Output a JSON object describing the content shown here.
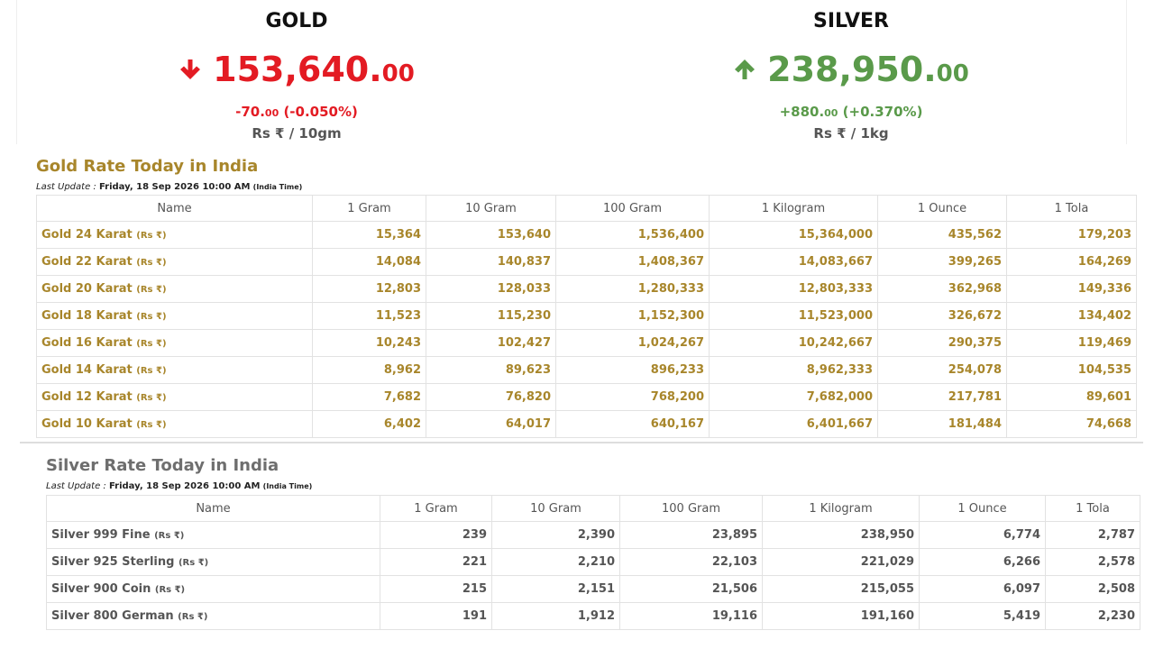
{
  "gold_ticker": {
    "title": "GOLD",
    "price_main": "153,640.",
    "price_decimal": "00",
    "change_amount": "-70.",
    "change_decimal": "00",
    "change_percent": " (-0.050%)",
    "unit": "Rs ₹ / 10gm",
    "direction": "down",
    "color": "#e31b23"
  },
  "silver_ticker": {
    "title": "SILVER",
    "price_main": "238,950.",
    "price_decimal": "00",
    "change_amount": "+880.",
    "change_decimal": "00",
    "change_percent": " (+0.370%)",
    "unit": "Rs ₹ / 1kg",
    "direction": "up",
    "color": "#5a9a4a"
  },
  "gold_table": {
    "title": "Gold Rate Today in India",
    "last_update_label": "Last Update :",
    "last_update_date": "Friday, 18 Sep 2026 10:00 AM",
    "last_update_zone": "(India Time)",
    "headers": [
      "Name",
      "1 Gram",
      "10 Gram",
      "100 Gram",
      "1 Kilogram",
      "1 Ounce",
      "1 Tola"
    ],
    "currency_tag": "(Rs ₹)",
    "rows": [
      {
        "name": "Gold 24 Karat",
        "values": [
          "15,364",
          "153,640",
          "1,536,400",
          "15,364,000",
          "435,562",
          "179,203"
        ]
      },
      {
        "name": "Gold 22 Karat",
        "values": [
          "14,084",
          "140,837",
          "1,408,367",
          "14,083,667",
          "399,265",
          "164,269"
        ]
      },
      {
        "name": "Gold 20 Karat",
        "values": [
          "12,803",
          "128,033",
          "1,280,333",
          "12,803,333",
          "362,968",
          "149,336"
        ]
      },
      {
        "name": "Gold 18 Karat",
        "values": [
          "11,523",
          "115,230",
          "1,152,300",
          "11,523,000",
          "326,672",
          "134,402"
        ]
      },
      {
        "name": "Gold 16 Karat",
        "values": [
          "10,243",
          "102,427",
          "1,024,267",
          "10,242,667",
          "290,375",
          "119,469"
        ]
      },
      {
        "name": "Gold 14 Karat",
        "values": [
          "8,962",
          "89,623",
          "896,233",
          "8,962,333",
          "254,078",
          "104,535"
        ]
      },
      {
        "name": "Gold 12 Karat",
        "values": [
          "7,682",
          "76,820",
          "768,200",
          "7,682,000",
          "217,781",
          "89,601"
        ]
      },
      {
        "name": "Gold 10 Karat",
        "values": [
          "6,402",
          "64,017",
          "640,167",
          "6,401,667",
          "181,484",
          "74,668"
        ]
      }
    ]
  },
  "silver_table": {
    "title": "Silver Rate Today in India",
    "last_update_label": "Last Update :",
    "last_update_date": "Friday, 18 Sep 2026 10:00 AM",
    "last_update_zone": "(India Time)",
    "headers": [
      "Name",
      "1 Gram",
      "10 Gram",
      "100 Gram",
      "1 Kilogram",
      "1 Ounce",
      "1 Tola"
    ],
    "currency_tag": "(Rs ₹)",
    "rows": [
      {
        "name": "Silver 999 Fine",
        "values": [
          "239",
          "2,390",
          "23,895",
          "238,950",
          "6,774",
          "2,787"
        ]
      },
      {
        "name": "Silver 925 Sterling",
        "values": [
          "221",
          "2,210",
          "22,103",
          "221,029",
          "6,266",
          "2,578"
        ]
      },
      {
        "name": "Silver 900 Coin",
        "values": [
          "215",
          "2,151",
          "21,506",
          "215,055",
          "6,097",
          "2,508"
        ]
      },
      {
        "name": "Silver 800 German",
        "values": [
          "191",
          "1,912",
          "19,116",
          "191,160",
          "5,419",
          "2,230"
        ]
      }
    ]
  }
}
